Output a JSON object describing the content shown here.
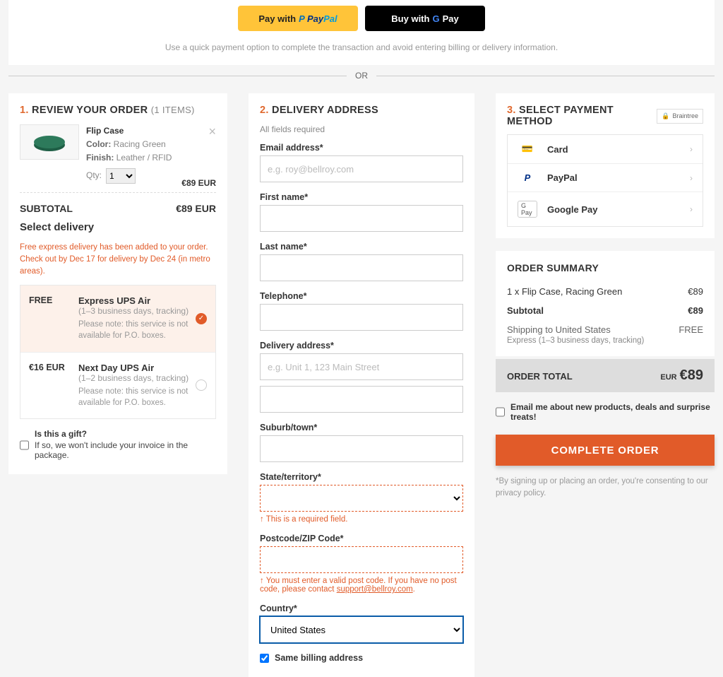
{
  "quickpay": {
    "paypal_prefix": "Pay with",
    "gpay_prefix": "Buy with",
    "gpay_text": "Pay",
    "hint": "Use a quick payment option to complete the transaction and avoid entering billing or delivery information.",
    "or": "OR"
  },
  "review": {
    "num": "1.",
    "title": "REVIEW YOUR ORDER",
    "count": "(1 ITEMS)",
    "product": {
      "name": "Flip Case",
      "color_k": "Color:",
      "color_v": "Racing Green",
      "finish_k": "Finish:",
      "finish_v": "Leather / RFID",
      "qty_label": "Qty:",
      "qty_value": "1",
      "price": "€89 EUR"
    },
    "subtotal_label": "SUBTOTAL",
    "subtotal_value": "€89 EUR",
    "select_delivery": "Select delivery",
    "notice": "Free express delivery has been added to your order. Check out by Dec 17 for delivery by Dec 24 (in metro areas).",
    "options": [
      {
        "price": "FREE",
        "name": "Express UPS Air",
        "time": "(1–3 business days, tracking)",
        "note": "Please note: this service is not available for P.O. boxes.",
        "selected": true
      },
      {
        "price": "€16 EUR",
        "name": "Next Day UPS Air",
        "time": "(1–2 business days, tracking)",
        "note": "Please note: this service is not available for P.O. boxes.",
        "selected": false
      }
    ],
    "gift_q": "Is this a gift?",
    "gift_desc": "If so, we won't include your invoice in the package."
  },
  "delivery": {
    "num": "2.",
    "title": "DELIVERY ADDRESS",
    "req": "All fields required",
    "email_label": "Email address*",
    "email_ph": "e.g. roy@bellroy.com",
    "first_label": "First name*",
    "last_label": "Last name*",
    "tel_label": "Telephone*",
    "addr_label": "Delivery address*",
    "addr_ph": "e.g. Unit 1, 123 Main Street",
    "suburb_label": "Suburb/town*",
    "state_label": "State/territory*",
    "state_err": "↑  This is a required field.",
    "zip_label": "Postcode/ZIP Code*",
    "zip_err_pre": "↑  You must enter a valid post code. If you have no post code, please contact ",
    "zip_err_link": "support@bellroy.com",
    "country_label": "Country*",
    "country_value": "United States",
    "same_billing": "Same billing address"
  },
  "payment": {
    "num": "3.",
    "title": "SELECT PAYMENT METHOD",
    "braintree": "Braintree",
    "card": "Card",
    "paypal": "PayPal",
    "gpay": "Google Pay"
  },
  "summary": {
    "title": "ORDER SUMMARY",
    "item_line": "1 x Flip Case, Racing Green",
    "item_price": "€89",
    "subtotal_label": "Subtotal",
    "subtotal_val": "€89",
    "ship_label": "Shipping to United States",
    "ship_val": "FREE",
    "ship_method": "Express (1–3 business days, tracking)",
    "total_label": "ORDER TOTAL",
    "total_cur": "EUR",
    "total_val": "€89",
    "email_me": "Email me about new products, deals and surprise treats!",
    "complete": "COMPLETE ORDER",
    "disclaimer": "*By signing up or placing an order, you're consenting to our privacy policy."
  }
}
